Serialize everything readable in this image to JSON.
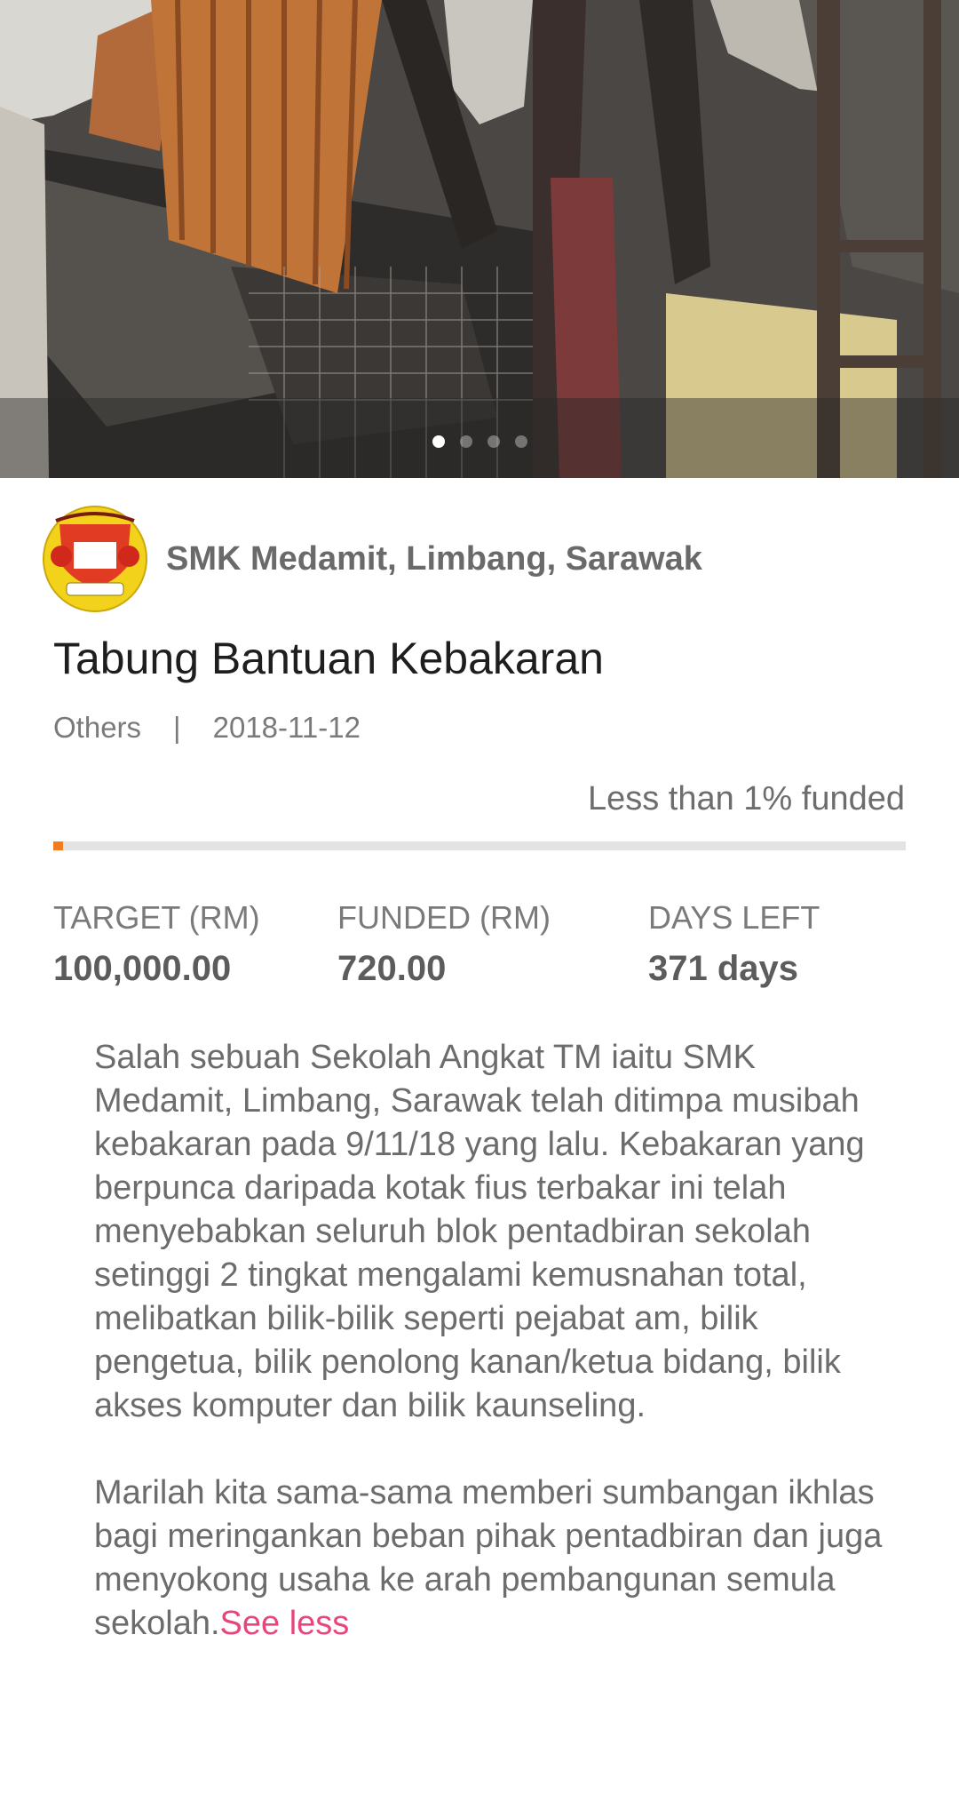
{
  "campaign": {
    "org_name": "SMK Medamit, Limbang, Sarawak",
    "title": "Tabung Bantuan Kebakaran",
    "category": "Others",
    "separator": "|",
    "date": "2018-11-12",
    "funded_status": "Less than 1% funded",
    "progress_fraction": 0.0072
  },
  "carousel": {
    "page_count": 4,
    "active_index": 0
  },
  "stats": {
    "target_label": "TARGET (RM)",
    "target_value": "100,000.00",
    "funded_label": "FUNDED (RM)",
    "funded_value": "720.00",
    "days_label": "DAYS LEFT",
    "days_value": "371 days"
  },
  "description": {
    "paragraph1": "Salah sebuah Sekolah Angkat TM iaitu SMK Medamit, Limbang, Sarawak telah ditimpa musibah kebakaran pada 9/11/18 yang lalu. Kebakaran yang berpunca daripada kotak fius terbakar ini telah menyebabkan seluruh blok pentadbiran sekolah setinggi 2 tingkat mengalami kemusnahan total, melibatkan bilik-bilik seperti pejabat am, bilik pengetua, bilik penolong kanan/ketua bidang, bilik akses komputer dan bilik kaunseling.",
    "paragraph2": "Marilah kita sama-sama memberi sumbangan ikhlas bagi meringankan beban pihak pentadbiran dan juga menyokong usaha ke arah pembangunan semula sekolah.",
    "toggle_label": "See less"
  },
  "colors": {
    "accent": "#f47c20",
    "link": "#e8457f"
  }
}
